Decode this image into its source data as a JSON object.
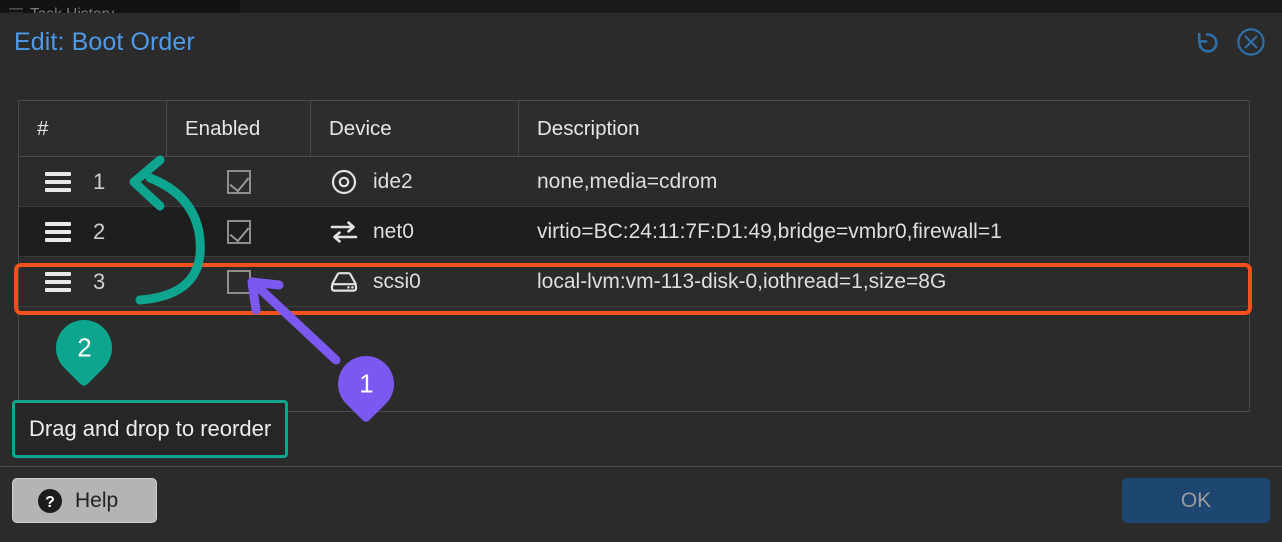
{
  "background": {
    "tab_label": "Task History",
    "tab_icon": "list-icon"
  },
  "dialog": {
    "title": "Edit: Boot Order",
    "reset_icon": "undo-icon",
    "close_icon": "close-circle-icon",
    "accent_color": "#4c9ae8",
    "background_color": "#2b2b2b"
  },
  "table": {
    "columns": [
      "#",
      "Enabled",
      "Device",
      "Description"
    ],
    "rows": [
      {
        "index": "1",
        "enabled": true,
        "device": "ide2",
        "device_icon": "cdrom-icon",
        "description": "none,media=cdrom"
      },
      {
        "index": "2",
        "enabled": true,
        "device": "net0",
        "device_icon": "network-icon",
        "description": "virtio=BC:24:11:7F:D1:49,bridge=vmbr0,firewall=1"
      },
      {
        "index": "3",
        "enabled": false,
        "device": "scsi0",
        "device_icon": "harddisk-icon",
        "description": "local-lvm:vm-113-disk-0,iothread=1,size=8G"
      }
    ],
    "drag_handle_icon": "drag-handle-icon"
  },
  "footer": {
    "help_label": "Help",
    "help_icon": "question-circle-icon",
    "ok_label": "OK"
  },
  "annotations": {
    "badge_1": "1",
    "badge_2": "2",
    "note": "Drag and drop to reorder",
    "highlight_color": "#f4501e",
    "badge_1_color": "#7b58ef",
    "badge_2_color": "#0da58e"
  }
}
